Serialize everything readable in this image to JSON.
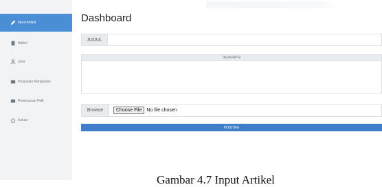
{
  "sidebar": {
    "items": [
      {
        "label": "Input Artikel",
        "icon": "pencil-icon",
        "active": true
      },
      {
        "label": "Artikel",
        "icon": "document-icon"
      },
      {
        "label": "User",
        "icon": "user-icon"
      },
      {
        "label": "Penjualan Rangkaian",
        "icon": "sales-icon"
      },
      {
        "label": "Pemesanan Pelli",
        "icon": "cart-icon"
      },
      {
        "label": "Keluar",
        "icon": "power-icon"
      }
    ]
  },
  "main": {
    "title": "Dashboard",
    "judul_label": "JUDUL",
    "judul_value": "",
    "deskripsi_label": "DESKRIPSI",
    "deskripsi_value": "",
    "browse_label": "Browse",
    "choose_file_label": "Choose File",
    "file_status": "No file chosen",
    "posting_label": "POSTING"
  },
  "caption": "Gambar 4.7 Input Artikel"
}
